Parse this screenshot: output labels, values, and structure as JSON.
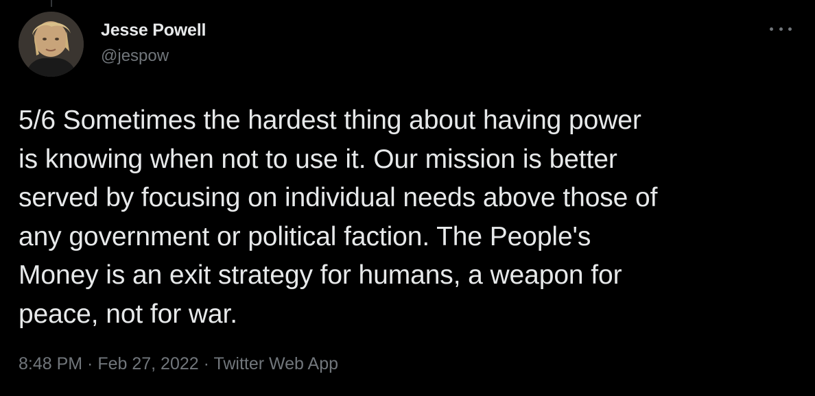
{
  "tweet": {
    "author": {
      "display_name": "Jesse Powell",
      "handle": "@jespow",
      "avatar_icon": "user-avatar-photo"
    },
    "more_icon": "more-options-icon",
    "text": "5/6 Sometimes the hardest thing about having power\nis knowing when not to use it. Our mission is better\nserved by focusing on individual needs above those of\nany government or political faction. The People's\nMoney is an exit strategy for humans, a weapon for\npeace, not for war.",
    "meta": {
      "time": "8:48 PM",
      "separator": " · ",
      "date": "Feb 27, 2022",
      "source": "Twitter Web App"
    }
  },
  "colors": {
    "background": "#000000",
    "primary_text": "#e7e9ea",
    "secondary_text": "#71767b"
  }
}
